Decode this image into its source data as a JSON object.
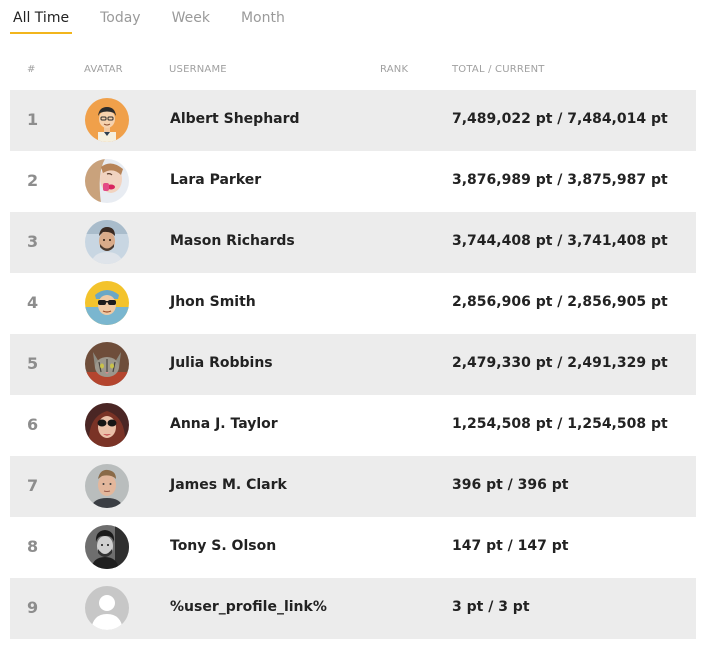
{
  "tabs": [
    {
      "label": "All Time",
      "active": true
    },
    {
      "label": "Today",
      "active": false
    },
    {
      "label": "Week",
      "active": false
    },
    {
      "label": "Month",
      "active": false
    }
  ],
  "accent_color": "#f2b51c",
  "columns": {
    "num": "#",
    "avatar": "AVATAR",
    "username": "USERNAME",
    "rank": "RANK",
    "total": "TOTAL / CURRENT"
  },
  "rows": [
    {
      "num": "1",
      "username": "Albert Shephard",
      "rank": "",
      "total": "7,489,022 pt / 7,484,014 pt",
      "avatar": "cartoon-man-avatar"
    },
    {
      "num": "2",
      "username": "Lara Parker",
      "rank": "",
      "total": "3,876,989 pt / 3,875,987 pt",
      "avatar": "woman-photo-avatar"
    },
    {
      "num": "3",
      "username": "Mason Richards",
      "rank": "",
      "total": "3,744,408 pt / 3,741,408 pt",
      "avatar": "man-photo-avatar"
    },
    {
      "num": "4",
      "username": "Jhon Smith",
      "rank": "",
      "total": "2,856,906 pt / 2,856,905 pt",
      "avatar": "sunglasses-kid-avatar"
    },
    {
      "num": "5",
      "username": "Julia Robbins",
      "rank": "",
      "total": "2,479,330 pt / 2,491,329 pt",
      "avatar": "cat-photo-avatar"
    },
    {
      "num": "6",
      "username": "Anna J. Taylor",
      "rank": "",
      "total": "1,254,508 pt / 1,254,508 pt",
      "avatar": "woman-sunglasses-avatar"
    },
    {
      "num": "7",
      "username": "James M. Clark",
      "rank": "",
      "total": "396 pt / 396 pt",
      "avatar": "man-portrait-avatar"
    },
    {
      "num": "8",
      "username": "Tony S. Olson",
      "rank": "",
      "total": "147 pt / 147 pt",
      "avatar": "bw-man-avatar"
    },
    {
      "num": "9",
      "username": "%user_profile_link%",
      "rank": "",
      "total": "3 pt / 3 pt",
      "avatar": "default-user-avatar"
    }
  ]
}
